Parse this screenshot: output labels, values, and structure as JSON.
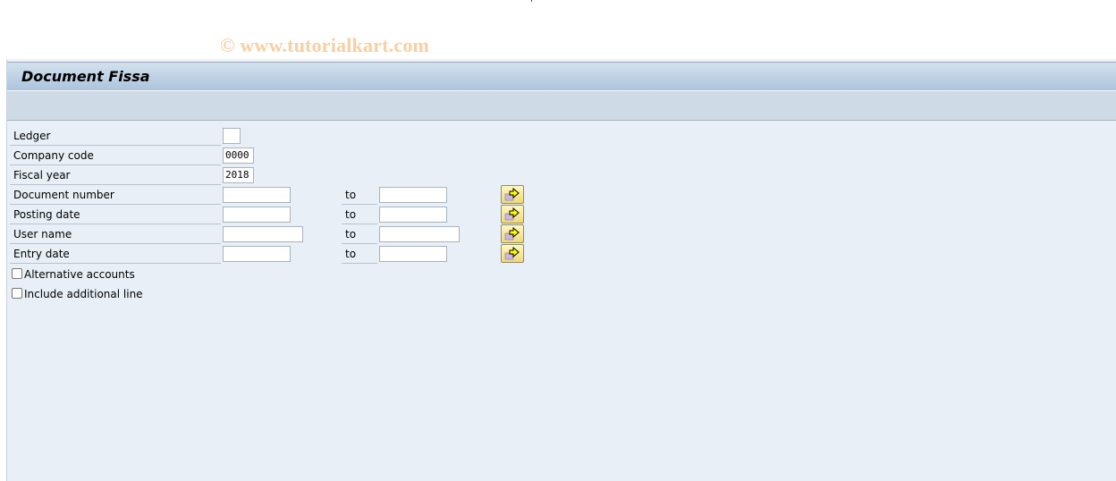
{
  "watermark": "© www.tutorialkart.com",
  "header": {
    "title": "Document Fissa"
  },
  "form": {
    "ledger": {
      "label": "Ledger",
      "value": ""
    },
    "company_code": {
      "label": "Company code",
      "value": "0000"
    },
    "fiscal_year": {
      "label": "Fiscal year",
      "value": "2018"
    },
    "ranges": [
      {
        "label": "Document number",
        "from": "",
        "to_label": "to",
        "to": "",
        "button": "multiple-selection-icon"
      },
      {
        "label": "Posting date",
        "from": "",
        "to_label": "to",
        "to": "",
        "button": "multiple-selection-icon"
      },
      {
        "label": "User name",
        "from": "",
        "to_label": "to",
        "to": "",
        "button": "multiple-selection-icon"
      },
      {
        "label": "Entry date",
        "from": "",
        "to_label": "to",
        "to": "",
        "button": "multiple-selection-icon"
      }
    ],
    "checkboxes": [
      {
        "label": "Alternative accounts",
        "checked": false
      },
      {
        "label": "Include additional line",
        "checked": false
      }
    ]
  }
}
